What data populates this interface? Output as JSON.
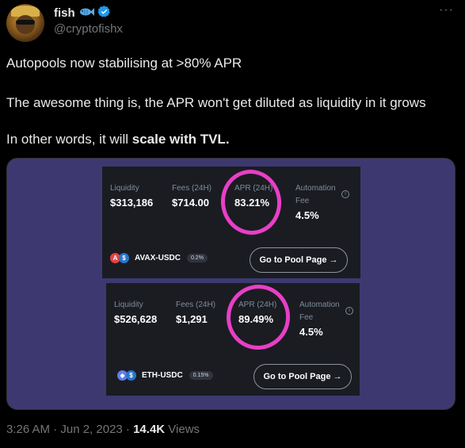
{
  "author": {
    "name": "fish",
    "handle": "@cryptofishx",
    "emoji_icon": "fish-emoji",
    "verified_icon": "verified-badge"
  },
  "tweet": {
    "line1": "Autopools now stabilising at >80% APR",
    "line2": "The awesome thing is, the APR won't get diluted as liquidity in it grows",
    "line3_prefix": "In other words, it will ",
    "line3_bold": "scale with TVL."
  },
  "pools": [
    {
      "liquidity_label": "Liquidity",
      "liquidity_value": "$313,186",
      "fees_label": "Fees (24H)",
      "fees_value": "$714.00",
      "apr_label": "APR (24H)",
      "apr_value": "83.21%",
      "automation_label": "Automation",
      "automation_fee_label": "Fee",
      "automation_value": "4.5%",
      "pair": "AVAX-USDC",
      "fee_tier": "0.2%",
      "button": "Go to Pool Page →"
    },
    {
      "liquidity_label": "Liquidity",
      "liquidity_value": "$526,628",
      "fees_label": "Fees (24H)",
      "fees_value": "$1,291",
      "apr_label": "APR (24H)",
      "apr_value": "89.49%",
      "automation_label": "Automation",
      "automation_fee_label": "Fee",
      "automation_value": "4.5%",
      "pair": "ETH-USDC",
      "fee_tier": "0.15%",
      "button": "Go to Pool Page →"
    }
  ],
  "meta": {
    "time": "3:26 AM · Jun 2, 2023 · ",
    "views_count": "14.4K",
    "views_label": " Views"
  },
  "colors": {
    "background": "#000000",
    "media_bg": "#3d3970",
    "card_bg": "#1a1c22",
    "highlight_ring": "#e83fc6",
    "verified": "#1d9bf0"
  }
}
